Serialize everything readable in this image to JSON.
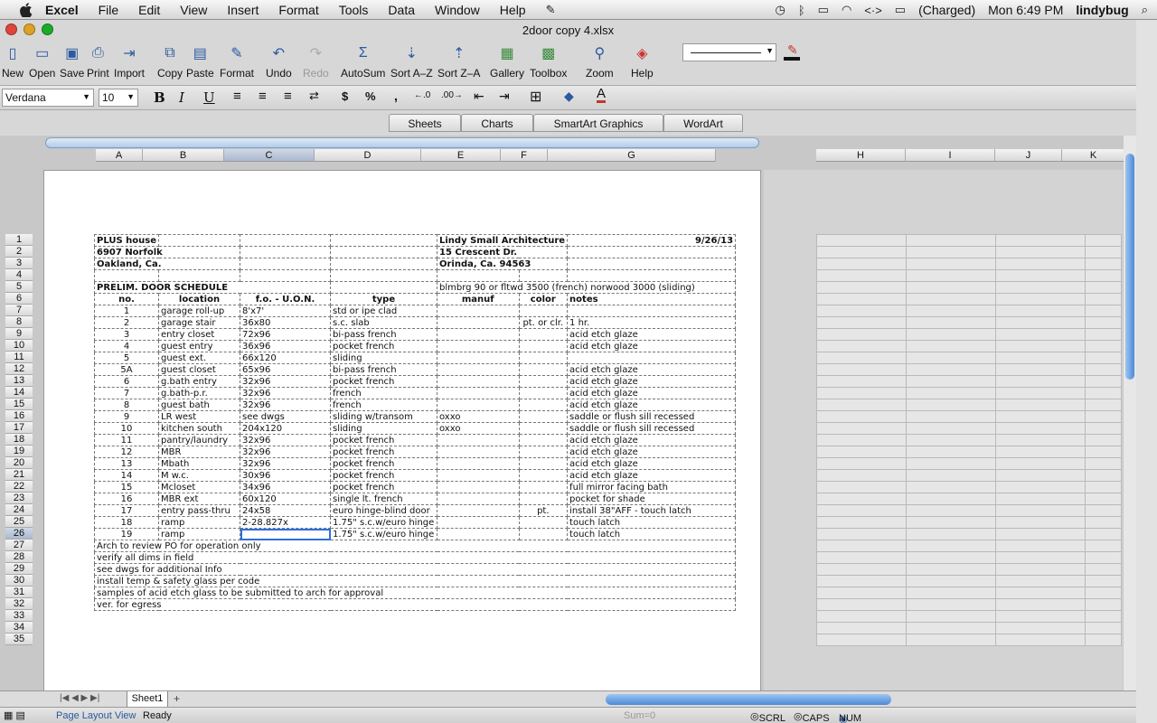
{
  "menubar": {
    "app": "Excel",
    "items": [
      "File",
      "Edit",
      "View",
      "Insert",
      "Format",
      "Tools",
      "Data",
      "Window",
      "Help"
    ],
    "battery": "(Charged)",
    "clock": "Mon 6:49 PM",
    "user": "lindybug"
  },
  "window": {
    "title": "2door  copy 4.xlsx"
  },
  "toolbar": {
    "buttons": [
      "New",
      "Open",
      "Save",
      "Print",
      "Import",
      "Copy",
      "Paste",
      "Format",
      "Undo",
      "Redo",
      "AutoSum",
      "Sort A–Z",
      "Sort Z–A",
      "Gallery",
      "Toolbox",
      "Zoom",
      "Help"
    ]
  },
  "format": {
    "font": "Verdana",
    "size": "10"
  },
  "ribbon_tabs": [
    "Sheets",
    "Charts",
    "SmartArt Graphics",
    "WordArt"
  ],
  "columns_left": [
    "A",
    "B",
    "C",
    "D",
    "E",
    "F",
    "G"
  ],
  "columns_right": [
    "H",
    "I",
    "J",
    "K"
  ],
  "rows": [
    "1",
    "2",
    "3",
    "4",
    "5",
    "6",
    "7",
    "8",
    "9",
    "10",
    "11",
    "12",
    "13",
    "14",
    "15",
    "16",
    "17",
    "18",
    "19",
    "20",
    "21",
    "22",
    "23",
    "24",
    "25",
    "26",
    "27",
    "28",
    "29",
    "30",
    "31",
    "32",
    "33",
    "34",
    "35"
  ],
  "sheet": {
    "r1": [
      "PLUS house",
      "",
      "",
      "Lindy Small Architecture",
      "",
      "9/26/13"
    ],
    "r2": [
      "6907 Norfolk",
      "",
      "",
      "15 Crescent Dr."
    ],
    "r3": [
      "Oakland, Ca.",
      "",
      "",
      "Orinda, Ca. 94563"
    ],
    "r5": [
      "PRELIM. DOOR SCHEDULE",
      "blmbrg 90 or fltwd 3500 (french) norwood 3000 (sliding)"
    ],
    "header": [
      "no.",
      "location",
      "f.o. - U.O.N.",
      "type",
      "manuf",
      "color",
      "notes"
    ],
    "doors": [
      [
        "1",
        "garage roll-up",
        "8'x7'",
        "std or ipe clad",
        "",
        "",
        ""
      ],
      [
        "2",
        "garage stair",
        "36x80",
        "s.c. slab",
        "",
        "pt. or clr.",
        "1 hr."
      ],
      [
        "3",
        "entry closet",
        "72x96",
        "bi-pass french",
        "",
        "",
        "acid etch glaze"
      ],
      [
        "4",
        "guest entry",
        "36x96",
        "pocket french",
        "",
        "",
        "acid etch glaze"
      ],
      [
        "5",
        "guest ext.",
        "66x120",
        "sliding",
        "",
        "",
        ""
      ],
      [
        "5A",
        "guest closet",
        "65x96",
        "bi-pass french",
        "",
        "",
        "acid etch glaze"
      ],
      [
        "6",
        "g.bath entry",
        "32x96",
        "pocket french",
        "",
        "",
        "acid etch glaze"
      ],
      [
        "7",
        "g.bath-p.r.",
        "32x96",
        "french",
        "",
        "",
        "acid etch glaze"
      ],
      [
        "8",
        "guest bath",
        "32x96",
        "french",
        "",
        "",
        "acid etch glaze"
      ],
      [
        "9",
        "LR west",
        "see dwgs",
        "sliding w/transom",
        "oxxo",
        "",
        "saddle or flush sill recessed"
      ],
      [
        "10",
        "kitchen south",
        "204x120",
        "sliding",
        "oxxo",
        "",
        "saddle or flush sill recessed"
      ],
      [
        "11",
        "pantry/laundry",
        "32x96",
        "pocket french",
        "",
        "",
        "acid etch glaze"
      ],
      [
        "12",
        "MBR",
        "32x96",
        "pocket french",
        "",
        "",
        "acid etch glaze"
      ],
      [
        "13",
        "Mbath",
        "32x96",
        "pocket french",
        "",
        "",
        "acid etch glaze"
      ],
      [
        "14",
        "M w.c.",
        "30x96",
        "pocket french",
        "",
        "",
        "acid etch glaze"
      ],
      [
        "15",
        "Mcloset",
        "34x96",
        "pocket french",
        "",
        "",
        "full mirror facing bath"
      ],
      [
        "16",
        "MBR ext",
        "60x120",
        "single lt. french",
        "",
        "",
        "pocket for shade"
      ],
      [
        "17",
        "entry pass-thru",
        "24x58",
        "euro hinge-blind door",
        "",
        "pt.",
        "install 38\"AFF - touch latch"
      ],
      [
        "18",
        "ramp",
        "2-28.827x",
        "1.75\" s.c.w/euro hinge",
        "",
        "",
        "touch latch"
      ],
      [
        "19",
        "ramp",
        "",
        "1.75\" s.c.w/euro hinge",
        "",
        "",
        "touch latch"
      ]
    ],
    "notes": [
      "Arch to review PO for operation only",
      "verify all dims in field",
      "see dwgs for additional Info",
      "install temp & safety glass per code",
      "samples of acid etch glass to be submitted to arch for approval",
      "ver. for egress"
    ]
  },
  "sheet_tab": "Sheet1",
  "status": {
    "view": "Page Layout View",
    "state": "Ready",
    "sum": "Sum=0",
    "scrl": "SCRL",
    "caps": "CAPS",
    "num": "NUM"
  }
}
